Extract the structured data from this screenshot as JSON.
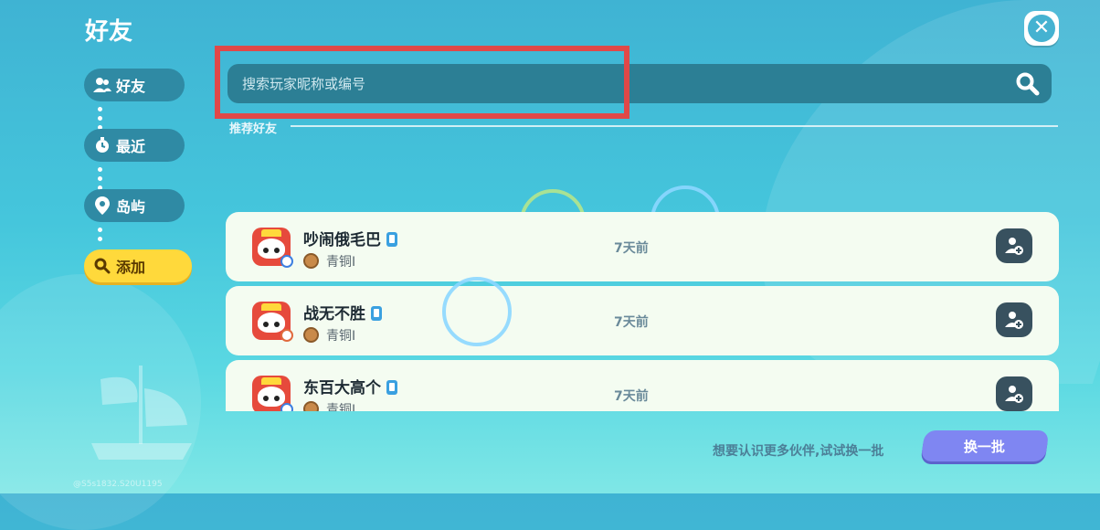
{
  "header": {
    "title": "好友"
  },
  "sidebar": {
    "items": [
      {
        "label": "好友",
        "icon": "users-icon"
      },
      {
        "label": "最近",
        "icon": "clock-icon"
      },
      {
        "label": "岛屿",
        "icon": "location-pin-icon"
      },
      {
        "label": "添加",
        "icon": "search-icon",
        "active": true
      }
    ]
  },
  "search": {
    "placeholder": "搜索玩家昵称或编号",
    "value": ""
  },
  "section": {
    "label": "推荐好友"
  },
  "friends": [
    {
      "name": "吵闹俄毛巴",
      "rank": "青铜I",
      "last_seen": "7天前"
    },
    {
      "name": "战无不胜",
      "rank": "青铜I",
      "last_seen": "7天前"
    },
    {
      "name": "东百大高个",
      "rank": "青铜I",
      "last_seen": "7天前"
    }
  ],
  "footer": {
    "hint": "想要认识更多伙伴,试试换一批",
    "refresh_label": "换一批"
  },
  "watermark": "@S5s1832.S20U1195",
  "colors": {
    "accent_yellow": "#ffd93b",
    "highlight_red": "#e04848",
    "refresh_purple": "#7f86f2"
  }
}
